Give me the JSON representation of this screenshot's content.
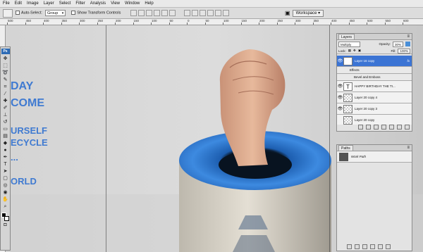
{
  "menu": [
    "File",
    "Edit",
    "Image",
    "Layer",
    "Select",
    "Filter",
    "Analysis",
    "View",
    "Window",
    "Help"
  ],
  "options": {
    "auto_select_label": "Auto-Select:",
    "auto_select_value": "Group",
    "show_transform_label": "Show Transform Controls"
  },
  "workspace_label": "Workspace ▾",
  "ruler_ticks": [
    "500",
    "450",
    "400",
    "350",
    "300",
    "250",
    "200",
    "150",
    "100",
    "50",
    "0",
    "50",
    "100",
    "150",
    "200",
    "250",
    "300",
    "350",
    "400",
    "450",
    "500",
    "550",
    "600"
  ],
  "poster_text": {
    "line1": "DAY",
    "line2": "COME",
    "line3": "URSELF",
    "line4": "ECYCLE",
    "line5": "...",
    "line6": "ORLD"
  },
  "toolbox_logo": "Ps",
  "layers_panel": {
    "tab": "Layers",
    "blend_mode": "Multiply",
    "opacity_label": "Opacity:",
    "opacity_value": "30%",
    "lock_label": "Lock:",
    "fill_label": "Fill:",
    "fill_value": "100%",
    "rows": [
      {
        "name": "Layer 16 copy",
        "fx": "fx"
      },
      {
        "name": "Effects"
      },
      {
        "name": "Bevel and Emboss"
      },
      {
        "name": "HAPPY BIRTHDAY THE TI..."
      },
      {
        "name": "Layer 20 copy 4"
      },
      {
        "name": "Layer 20 copy 3"
      },
      {
        "name": "Layer 20 copy"
      }
    ]
  },
  "paths_panel": {
    "tab": "Paths",
    "row": "Work Path"
  },
  "colors": {
    "poster_blue": "#3f7ad1",
    "bin_blue": "#2f79d4",
    "selection": "#3b74d4"
  }
}
